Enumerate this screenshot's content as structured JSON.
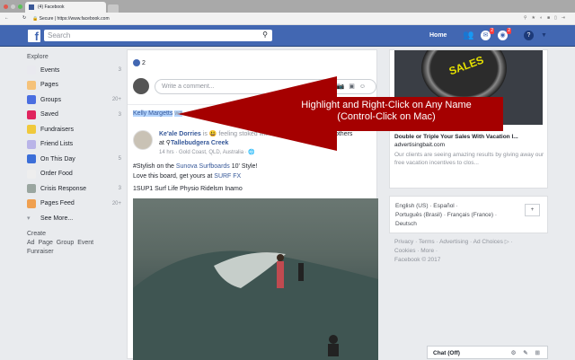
{
  "browser": {
    "tab_title": "(4) Facebook",
    "secure_label": "Secure",
    "url": "https://www.facebook.com"
  },
  "header": {
    "search_placeholder": "Search",
    "home": "Home",
    "friend_requests": "",
    "messages_badge": "2",
    "notifications_badge": "2"
  },
  "sidebar": {
    "explore": "Explore",
    "items": [
      {
        "label": "Events",
        "count": "3",
        "color": "#e9e9ef"
      },
      {
        "label": "Pages",
        "count": "",
        "color": "#f5c27a"
      },
      {
        "label": "Groups",
        "count": "20+",
        "color": "#4a6ee0"
      },
      {
        "label": "Saved",
        "count": "3",
        "color": "#e0245e"
      },
      {
        "label": "Fundraisers",
        "count": "",
        "color": "#f0c93c"
      },
      {
        "label": "Friend Lists",
        "count": "",
        "color": "#b9b4e8"
      },
      {
        "label": "On This Day",
        "count": "5",
        "color": "#3b6ed8"
      },
      {
        "label": "Order Food",
        "count": "",
        "color": "#eeeeee"
      },
      {
        "label": "Crisis Response",
        "count": "3",
        "color": "#9aa6a0"
      },
      {
        "label": "Pages Feed",
        "count": "20+",
        "color": "#f0a050"
      }
    ],
    "see_more": "See More...",
    "create": "Create",
    "create_links": "Ad  Page  Group  Event",
    "fundraiser": "Funraiser"
  },
  "feed": {
    "likes": "2",
    "comment_placeholder": "Write a comment...",
    "highlighted_name": "Kelly Margetts",
    "was": "wa",
    "post": {
      "author": "Ke'ale Dorries",
      "feeling": "is 😃 feeling stoked with",
      "others": "others",
      "at": "at",
      "place": "Tallebudgera Creek",
      "meta": "14 hrs · Gold Coast, QLD, Australia · 🌐",
      "line1_a": "#Stylish on the ",
      "line1_link": "Sunova Surfboards",
      "line1_b": " 10' Style!",
      "line2_a": "Love this board, get yours at ",
      "line2_link": "SURF FX",
      "line3": "1SUP1 Surf Life Physio Ridelsm Inamo"
    }
  },
  "ad": {
    "image_text": "SALES",
    "title": "Double or Triple Your Sales With Vacation I...",
    "domain": "advertisingbait.com",
    "body": "Our clients are seeing amazing results by giving away our free vacation incentives to clos..."
  },
  "languages": {
    "line1": "English (US) · Español ·",
    "line2": "Português (Brasil) · Français (France) ·",
    "line3": "Deutsch",
    "plus": "+"
  },
  "footer": {
    "line1": "Privacy · Terms · Advertising · Ad Choices ▷ ·",
    "line2": "Cookies · More ·",
    "line3": "Facebook © 2017"
  },
  "chat": {
    "label": "Chat (Off)",
    "icons": "⚙ ✎ ⊞"
  },
  "callout": {
    "line1": "Highlight and Right-Click on Any Name",
    "line2": "(Control-Click on Mac)",
    "color": "#a50000"
  }
}
